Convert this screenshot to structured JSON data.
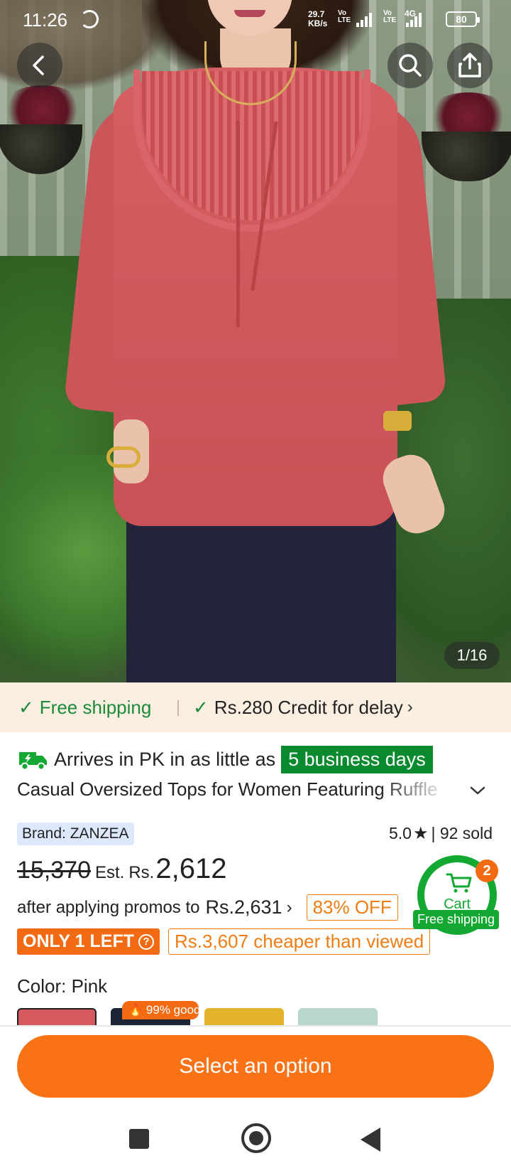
{
  "status_bar": {
    "time": "11:26",
    "network_speed_value": "29.7",
    "network_speed_unit": "KB/s",
    "signal1_label": "Vo LTE",
    "signal2_label": "Vo LTE",
    "network_type": "4G",
    "battery": "80"
  },
  "gallery": {
    "counter": "1/16"
  },
  "shipping_strip": {
    "free_shipping": "Free shipping",
    "credit": "Rs.280 Credit for delay"
  },
  "arrival": {
    "text": "Arrives in PK in as little as",
    "days": "5 business days"
  },
  "product": {
    "title": "Casual Oversized Tops for Women Featuring Ruffle",
    "brand": "Brand: ZANZEA",
    "rating": "5.0",
    "sold": "| 92 sold",
    "old_price": "15,370",
    "est_label": "Est.",
    "currency": "Rs.",
    "price": "2,612",
    "promo_text": "after applying promos to",
    "promo_price": "Rs.2,631",
    "discount": "83% OFF",
    "stock": "ONLY 1 LEFT",
    "cheaper": "Rs.3,607 cheaper than viewed"
  },
  "cart": {
    "label": "Cart",
    "count": "2",
    "shipping": "Free shipping"
  },
  "color": {
    "label": "Color: Pink",
    "badge": "99% good"
  },
  "cta": {
    "label": "Select an option"
  },
  "colors": {
    "accent": "#f97316",
    "green": "#12a832",
    "strip_bg": "#fdeee2"
  }
}
